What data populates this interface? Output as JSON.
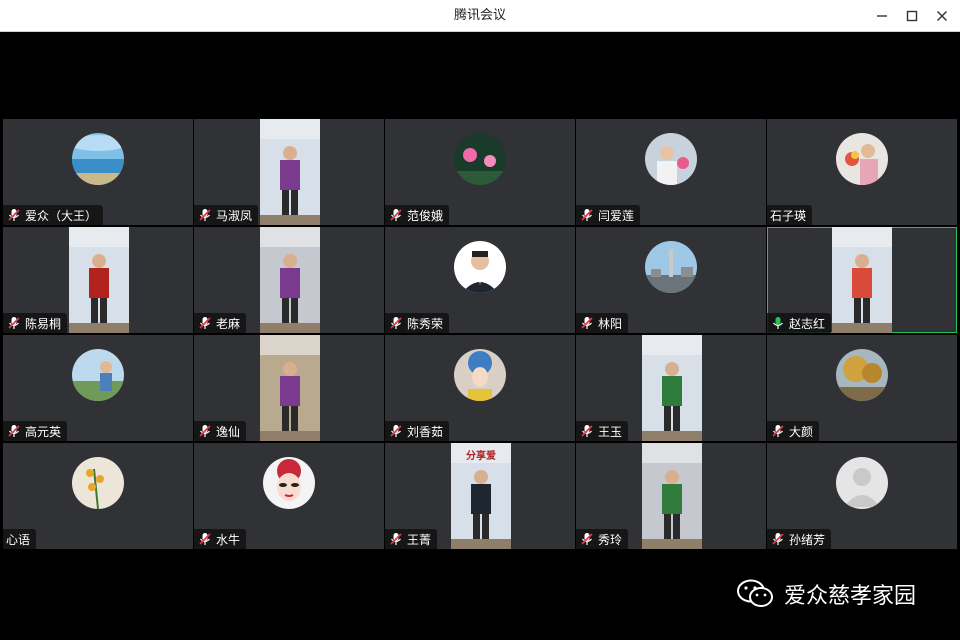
{
  "window": {
    "title": "腾讯会议",
    "colors": {
      "tile_bg": "#303235",
      "active_border": "#23c552",
      "muted_mic": "#e0364c",
      "live_mic": "#23c552"
    }
  },
  "participants": [
    {
      "name": "爱众（大王）",
      "mic": "muted",
      "media": "avatar",
      "avatar": "lake-landscape"
    },
    {
      "name": "马淑凤",
      "mic": "muted",
      "media": "video"
    },
    {
      "name": "范俊娥",
      "mic": "muted",
      "media": "avatar",
      "avatar": "lotus-flowers"
    },
    {
      "name": "闫爱莲",
      "mic": "muted",
      "media": "avatar",
      "avatar": "woman-photo"
    },
    {
      "name": "石子瑛",
      "mic": "none",
      "media": "avatar",
      "avatar": "woman-with-flowers"
    },
    {
      "name": "陈易桐",
      "mic": "muted",
      "media": "video"
    },
    {
      "name": "老麻",
      "mic": "muted",
      "media": "video"
    },
    {
      "name": "陈秀荣",
      "mic": "muted",
      "media": "avatar",
      "avatar": "man-portrait"
    },
    {
      "name": "林阳",
      "mic": "muted",
      "media": "avatar",
      "avatar": "city-tower"
    },
    {
      "name": "赵志红",
      "mic": "live",
      "media": "video",
      "active": true
    },
    {
      "name": "高元英",
      "mic": "muted",
      "media": "avatar",
      "avatar": "woman-outdoors"
    },
    {
      "name": "逸仙",
      "mic": "muted",
      "media": "video"
    },
    {
      "name": "刘香茹",
      "mic": "muted",
      "media": "avatar",
      "avatar": "opera-headdress"
    },
    {
      "name": "王玉",
      "mic": "muted",
      "media": "video"
    },
    {
      "name": "大颜",
      "mic": "muted",
      "media": "avatar",
      "avatar": "autumn-trees"
    },
    {
      "name": "心语",
      "mic": "none",
      "media": "avatar",
      "avatar": "orchid-flowers"
    },
    {
      "name": "水牛",
      "mic": "muted",
      "media": "avatar",
      "avatar": "opera-mask"
    },
    {
      "name": "王菁",
      "mic": "muted",
      "media": "video",
      "video_text": "分享爱"
    },
    {
      "name": "秀玲",
      "mic": "muted",
      "media": "video"
    },
    {
      "name": "孙绪芳",
      "mic": "muted",
      "media": "avatar",
      "avatar": "default-person"
    }
  ],
  "watermark": {
    "text": "爱众慈孝家园",
    "icon": "wechat-icon"
  }
}
